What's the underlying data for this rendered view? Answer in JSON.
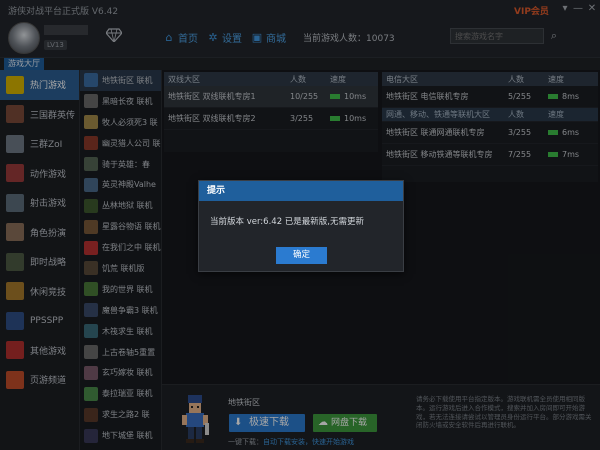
{
  "window": {
    "title": "游侠对战平台正式版 V6.42",
    "vip_label": "VIP会员",
    "controls": [
      "▾",
      "—",
      "✕"
    ]
  },
  "header": {
    "level_badge": "LV13",
    "nav": [
      {
        "icon": "home-icon",
        "label": "首页"
      },
      {
        "icon": "gear-icon",
        "label": "设置"
      },
      {
        "icon": "shop-icon",
        "label": "商城"
      }
    ],
    "online_label": "当前游戏人数：",
    "online_count": "10073",
    "search_placeholder": "搜索游戏名字"
  },
  "tabs": {
    "lobby": "游戏大厅"
  },
  "categories": [
    {
      "label": "热门游戏",
      "color": "#d8b400",
      "active": true
    },
    {
      "label": "三国群英传",
      "color": "#7b4a3a"
    },
    {
      "label": "三群ZoI",
      "color": "#6f7a86"
    },
    {
      "label": "动作游戏",
      "color": "#9a3b3b"
    },
    {
      "label": "射击游戏",
      "color": "#5d6e7c"
    },
    {
      "label": "角色扮演",
      "color": "#8b6f5a"
    },
    {
      "label": "即时战略",
      "color": "#4d5b44"
    },
    {
      "label": "休闲竞技",
      "color": "#a77a2b"
    },
    {
      "label": "PPSSPP",
      "color": "#2f4f86"
    },
    {
      "label": "其他游戏",
      "color": "#b3312e"
    },
    {
      "label": "页游频道",
      "color": "#c04d2a"
    }
  ],
  "games": [
    {
      "label": "地铁街区 联机",
      "color": "#3b6ea5",
      "active": true
    },
    {
      "label": "黑暗长夜 联机",
      "color": "#6a6a6a"
    },
    {
      "label": "牧人必须死3 联",
      "color": "#a48b4a"
    },
    {
      "label": "幽灵猎人公司 联",
      "color": "#8a3a2a"
    },
    {
      "label": "骑于英雄：春",
      "color": "#556655"
    },
    {
      "label": "英灵神殿Valhe",
      "color": "#4b6a8a"
    },
    {
      "label": "丛林地狱 联机",
      "color": "#3e5a2e"
    },
    {
      "label": "星露谷物语 联机",
      "color": "#7a5a3a"
    },
    {
      "label": "在我们之中 联机",
      "color": "#b83232"
    },
    {
      "label": "饥荒 联机版",
      "color": "#5a4a3a"
    },
    {
      "label": "我的世界 联机",
      "color": "#4a7a3a"
    },
    {
      "label": "魔兽争霸3 联机",
      "color": "#3a4a6a"
    },
    {
      "label": "木筏求生 联机",
      "color": "#3a6a7a"
    },
    {
      "label": "上古卷轴5重置",
      "color": "#6a6a6a"
    },
    {
      "label": "玄巧嫁妆 联机",
      "color": "#7a5a6a"
    },
    {
      "label": "泰拉瑞亚 联机",
      "color": "#4a8a4a"
    },
    {
      "label": "求生之路2 联",
      "color": "#5a3a2a"
    },
    {
      "label": "地下城堡 联机",
      "color": "#3a3a5a"
    }
  ],
  "panel_left": {
    "headers": [
      "双线大区",
      "人数",
      "速度"
    ],
    "rows": [
      {
        "name": "地铁街区 双线联机专房1",
        "count": "10/255",
        "speed": "10ms"
      },
      {
        "name": "地铁街区 双线联机专房2",
        "count": "3/255",
        "speed": "10ms"
      }
    ]
  },
  "panel_right": {
    "headers": [
      "电信大区",
      "人数",
      "速度"
    ],
    "rows": [
      {
        "name": "地铁街区 电信联机专房",
        "count": "5/255",
        "speed": "8ms",
        "type": "row"
      },
      {
        "name": "网通、移动、铁通等联机大区",
        "count": "人数",
        "speed": "速度",
        "type": "subhead"
      },
      {
        "name": "地铁街区 联通网通联机专房",
        "count": "3/255",
        "speed": "6ms",
        "type": "row"
      },
      {
        "name": "地铁街区 移动铁通等联机专房",
        "count": "7/255",
        "speed": "7ms",
        "type": "row"
      }
    ]
  },
  "bottom": {
    "title": "地铁街区",
    "download_label": "极速下载",
    "disk_label": "网盘下载",
    "tip_prefix": "一键下载：",
    "tip_text": "自动下载安装，快速开始游戏",
    "description": "请务必下载使用平台指定版本。游戏联机需全员使用相同版本。运行游戏后进入合作模式，搜索并加入房间即可开始游戏，若无法连接请尝试以管理员身份运行平台。部分游戏需关闭防火墙或安全软件后再进行联机。"
  },
  "dialog": {
    "title": "提示",
    "message": "当前版本 ver:6.42 已是最新版,无需更新",
    "ok_label": "确定"
  },
  "colors": {
    "accent": "#2b7bd0",
    "header_blue": "#1f5f9c",
    "signal_green": "#3fbf4a",
    "vip_orange": "#e15b2d"
  }
}
